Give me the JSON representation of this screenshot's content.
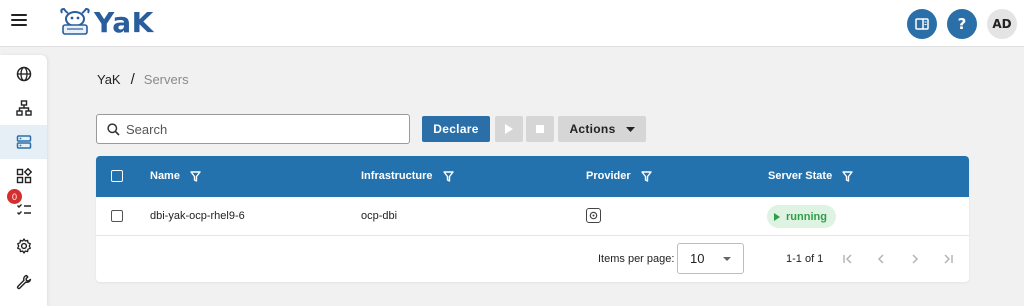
{
  "app": {
    "logo_text": "YaK"
  },
  "header": {
    "avatar_initials": "AD",
    "help_label": "?"
  },
  "sidenav": {
    "items": [
      {
        "name": "globe-icon"
      },
      {
        "name": "network-icon"
      },
      {
        "name": "servers-icon",
        "active": true
      },
      {
        "name": "components-icon"
      },
      {
        "name": "jobs-icon",
        "badge": "0"
      },
      {
        "name": "settings-icon"
      },
      {
        "name": "wrench-icon"
      }
    ]
  },
  "breadcrumb": {
    "home": "YaK",
    "separator": "/",
    "current": "Servers"
  },
  "toolbar": {
    "search_placeholder": "Search",
    "declare_label": "Declare",
    "actions_label": "Actions"
  },
  "table": {
    "columns": [
      "Name",
      "Infrastructure",
      "Provider",
      "Server State"
    ],
    "rows": [
      {
        "name": "dbi-yak-ocp-rhel9-6",
        "infrastructure": "ocp-dbi",
        "state": "running"
      }
    ]
  },
  "paginator": {
    "items_per_page_label": "Items per page:",
    "page_size": "10",
    "range_label": "1-1 of 1"
  },
  "colors": {
    "brand": "#2b6fa8",
    "table_header": "#2472ad",
    "running": "#2e9e48",
    "running_bg": "#dff3e2",
    "badge": "#d32f2f"
  }
}
